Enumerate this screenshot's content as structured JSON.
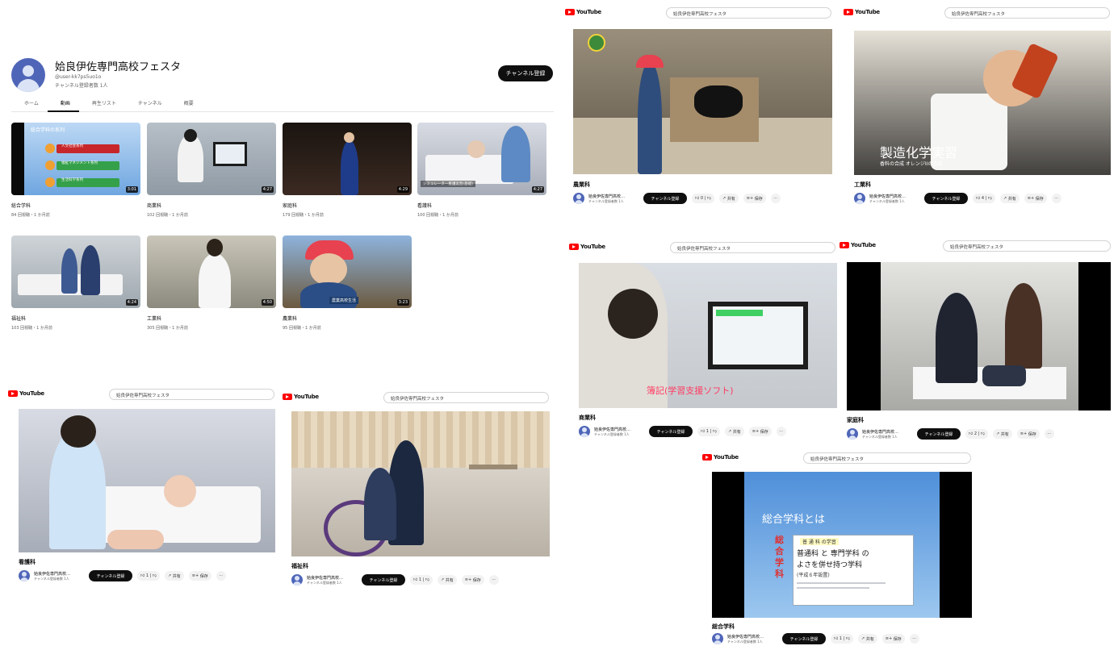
{
  "channel": {
    "name": "姶良伊佐専門高校フェスタ",
    "handle": "@user-kk7ps5uo1o",
    "subscribers": "チャンネル登録者数 1人",
    "subscribe_label": "チャンネル登録",
    "tabs": [
      "ホーム",
      "動画",
      "再生リスト",
      "チャンネル",
      "概要"
    ],
    "active_tab": "動画",
    "videos": [
      {
        "title": "総合学科",
        "meta": "84 回視聴・1 か月前",
        "duration": "3:01",
        "thumb_text": "総合学科の系列",
        "thumb_bars": [
          "人文社会系列",
          "福祉マネジメント系列",
          "生活科学系列"
        ]
      },
      {
        "title": "商業科",
        "meta": "102 回視聴・1 か月前",
        "duration": "4:27",
        "thumb_text": ""
      },
      {
        "title": "家庭科",
        "meta": "179 回視聴・1 か月前",
        "duration": "4:29",
        "thumb_text": ""
      },
      {
        "title": "看護科",
        "meta": "100 回視聴・1 か月前",
        "duration": "4:27",
        "thumb_text": "シミュレーター看護実習(基礎)"
      },
      {
        "title": "福祉科",
        "meta": "103 回視聴・1 か月前",
        "duration": "4:24",
        "thumb_text": ""
      },
      {
        "title": "工業科",
        "meta": "305 回視聴・1 か月前",
        "duration": "4:50",
        "thumb_text": ""
      },
      {
        "title": "農業科",
        "meta": "95 回視聴・1 か月前",
        "duration": "3:23",
        "thumb_text": "農業高校生活"
      }
    ]
  },
  "youtube_label": "YouTube",
  "video_pages": [
    {
      "search": "姶良伊佐専門高校フェスタ",
      "title": "農業科",
      "channel": "姶良伊佐専門高校…",
      "subs": "チャンネル登録者数 1人",
      "likes": "0",
      "subscribe_label": "チャンネル登録",
      "share_label": "共有",
      "save_label": "保存"
    },
    {
      "search": "姶良伊佐専門高校フェスタ",
      "title": "工業科",
      "channel": "姶良伊佐専門高校…",
      "subs": "チャンネル登録者数 1人",
      "likes": "4",
      "subscribe_label": "チャンネル登録",
      "share_label": "共有",
      "save_label": "保存",
      "caption_main": "製造化学実習",
      "caption_sub": "香料の合成 オレンジIIの合成"
    },
    {
      "search": "姶良伊佐専門高校フェスタ",
      "title": "商業科",
      "channel": "姶良伊佐専門高校…",
      "subs": "チャンネル登録者数 1人",
      "likes": "1",
      "subscribe_label": "チャンネル登録",
      "share_label": "共有",
      "save_label": "保存",
      "caption_main": "簿記(学習支援ソフト)"
    },
    {
      "search": "姶良伊佐専門高校フェスタ",
      "title": "家庭科",
      "channel": "姶良伊佐専門高校…",
      "subs": "チャンネル登録者数 1人",
      "likes": "2",
      "subscribe_label": "チャンネル登録",
      "share_label": "共有",
      "save_label": "保存"
    },
    {
      "search": "姶良伊佐専門高校フェスタ",
      "title": "看護科",
      "channel": "姶良伊佐専門高校…",
      "subs": "チャンネル登録者数 1人",
      "likes": "1",
      "subscribe_label": "チャンネル登録",
      "share_label": "共有",
      "save_label": "保存"
    },
    {
      "search": "姶良伊佐専門高校フェスタ",
      "title": "福祉科",
      "channel": "姶良伊佐専門高校…",
      "subs": "チャンネル登録者数 1人",
      "likes": "1",
      "subscribe_label": "チャンネル登録",
      "share_label": "共有",
      "save_label": "保存"
    },
    {
      "search": "姶良伊佐専門高校フェスタ",
      "title": "総合学科",
      "channel": "姶良伊佐専門高校…",
      "subs": "チャンネル登録者数 1人",
      "likes": "1",
      "subscribe_label": "チャンネル登録",
      "share_label": "共有",
      "save_label": "保存",
      "slide_heading": "総合学科とは",
      "slide_side": "総合学科",
      "slide_small": "普 通 科 の学習",
      "slide_line1": "普通科 と 専門学科 の",
      "slide_line2": "よさを併せ持つ学科",
      "slide_line3": "(平成６年設置)"
    }
  ]
}
